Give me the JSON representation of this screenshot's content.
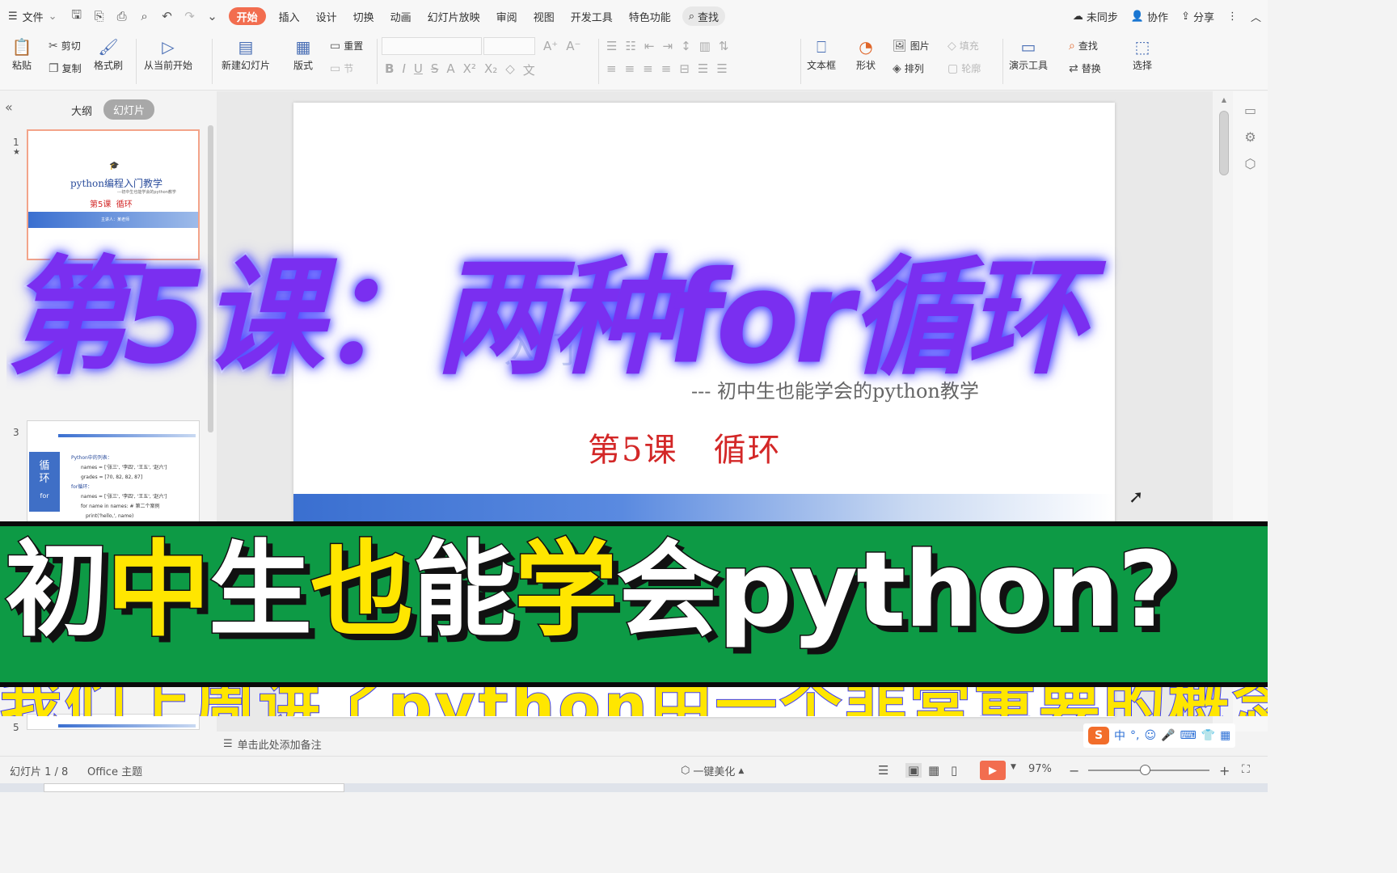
{
  "menubar": {
    "file": "文件",
    "tabs": [
      "开始",
      "插入",
      "设计",
      "切换",
      "动画",
      "幻灯片放映",
      "审阅",
      "视图",
      "开发工具",
      "特色功能"
    ],
    "search": "查找",
    "sync": "未同步",
    "collab": "协作",
    "share": "分享"
  },
  "ribbon": {
    "paste": "粘贴",
    "cut": "剪切",
    "copy": "复制",
    "format_painter": "格式刷",
    "from_current": "从当前开始",
    "new_slide": "新建幻灯片",
    "layout": "版式",
    "reset": "重置",
    "section": "节",
    "textbox": "文本框",
    "shape": "形状",
    "picture": "图片",
    "arrange": "排列",
    "fill": "填充",
    "outline": "轮廓",
    "present_tools": "演示工具",
    "find": "查找",
    "replace": "替换",
    "select": "选择"
  },
  "left_panel": {
    "tab_outline": "大纲",
    "tab_slides": "幻灯片",
    "thumb1": {
      "num": "1",
      "title": "python编程入门教学",
      "subtitle": "---初中生也能学会的python教学",
      "lesson": "第5课  循环",
      "author": "主讲人：某老师"
    },
    "thumb3": {
      "num": "3",
      "side_label": "循环",
      "side_sub": "for",
      "lines": [
        "Python中的列表：",
        "names = ['张三', '李四', '王五', '赵六']",
        "grades = [70, 82, 82, 87]",
        "for循环：",
        "names = ['张三', '李四', '王五', '赵六']",
        "for name in names:      # 第二个案例",
        "print('hello,', name)"
      ]
    },
    "thumb5": {
      "num": "5"
    }
  },
  "slide": {
    "fragment": "入门",
    "subtitle": "--- 初中生也能学会的python教学",
    "lesson": "第5课   循环"
  },
  "notes_placeholder": "单击此处添加备注",
  "statusbar": {
    "slide_count": "幻灯片 1 / 8",
    "theme": "Office 主题",
    "beautify": "一键美化",
    "zoom": "97%"
  },
  "overlay": {
    "title_top": "第5课：两种for循环",
    "band_parts": [
      "初",
      "中",
      "生",
      "也",
      "能",
      "学",
      "会",
      "python?"
    ],
    "under_caption": "我们上周讲了python中一个非常重要的概念"
  },
  "colors": {
    "accent": "#f26d4f",
    "title_purple": "#7a2ff0",
    "band_green": "#0d9a45",
    "highlight_yellow": "#ffe600",
    "lesson_red": "#d32727"
  }
}
